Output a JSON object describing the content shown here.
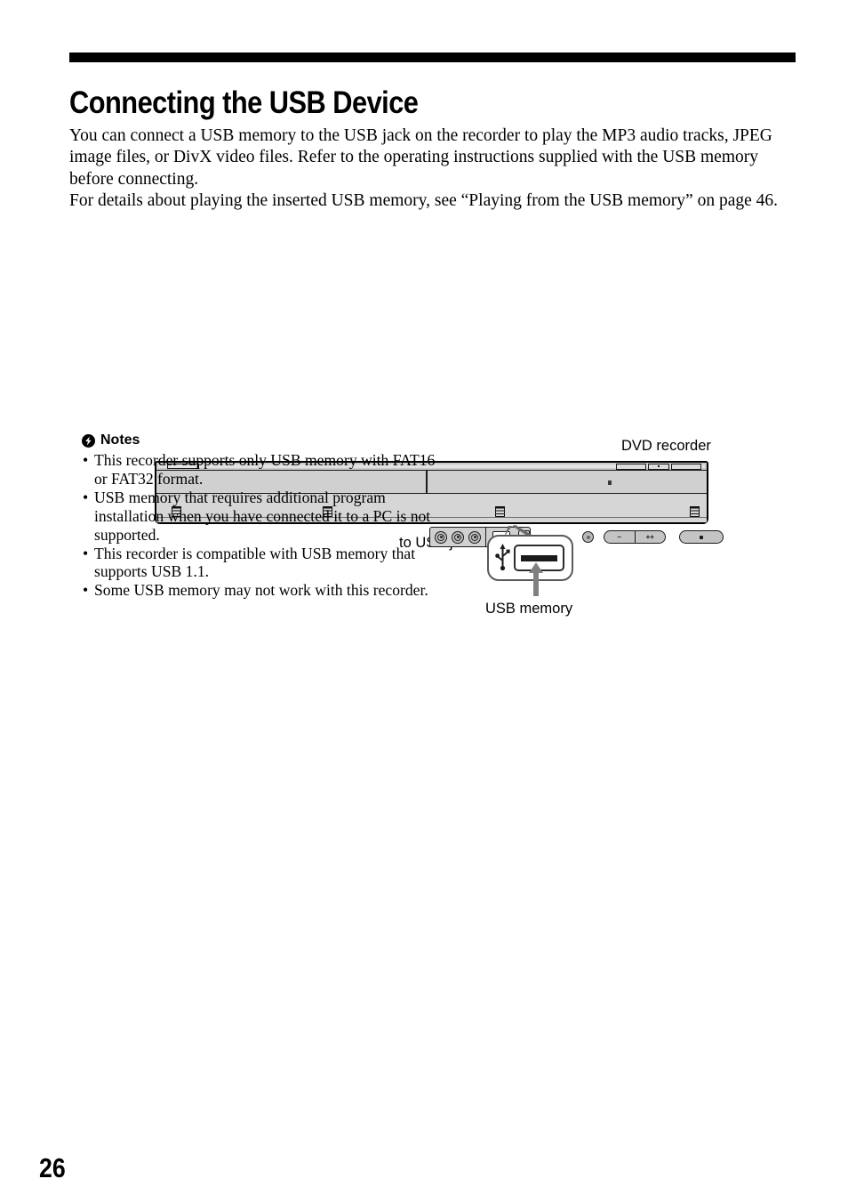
{
  "page": {
    "number": "26",
    "title": "Connecting the USB Device"
  },
  "intro": {
    "paragraph_1": "You can connect a USB memory to the USB jack on the recorder to play the MP3 audio tracks, JPEG image files, or DivX video files. Refer to the operating instructions supplied with the USB memory before connecting.",
    "paragraph_2": "For details about playing the inserted USB memory, see “Playing from the USB memory” on page 46."
  },
  "figure": {
    "labels": {
      "dvd_recorder": "DVD recorder",
      "to_usb_jack": "to USB jack",
      "usb_memory": "USB memory"
    },
    "recorder_controls": {
      "rocker_left": "–",
      "rocker_right": "++"
    }
  },
  "notes": {
    "heading": "Notes",
    "bullet": "•",
    "items": [
      "This recorder supports only USB memory with FAT16 or FAT32 format.",
      "USB memory that requires additional program installation when you have connected it to a PC is not supported.",
      "This recorder is compatible with USB memory that supports USB 1.1.",
      "Some USB memory may not work with this recorder."
    ]
  },
  "colors": {
    "rule": "#000000",
    "device_body": "#d3d3d3",
    "callout_border": "#5a5a5a",
    "arrow": "#808080"
  }
}
